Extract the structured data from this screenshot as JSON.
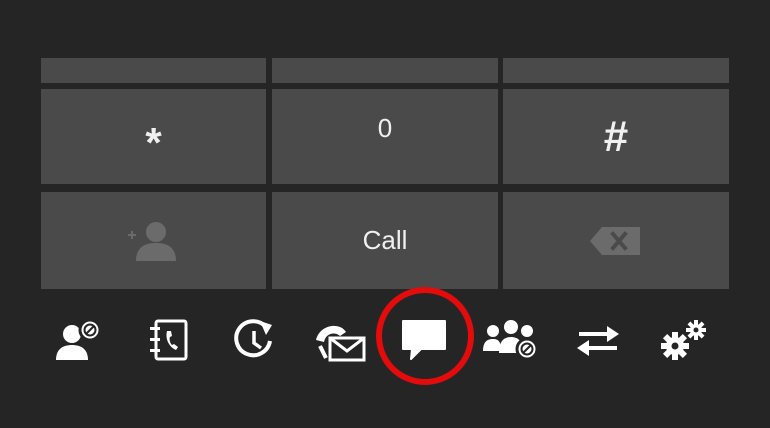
{
  "keypad": {
    "partial_row": [
      {
        "label": ""
      },
      {
        "label": ""
      },
      {
        "label": ""
      }
    ],
    "row2": {
      "star": "*",
      "zero": "0",
      "hash": "#"
    },
    "row3": {
      "add_contact_icon": "add-contact-icon",
      "call": "Call",
      "backspace_icon": "backspace-icon"
    }
  },
  "toolbar": {
    "items": [
      {
        "icon": "user-status-icon"
      },
      {
        "icon": "address-book-icon"
      },
      {
        "icon": "call-history-icon"
      },
      {
        "icon": "voicemail-icon"
      },
      {
        "icon": "chat-icon"
      },
      {
        "icon": "group-status-icon"
      },
      {
        "icon": "transfer-icon"
      },
      {
        "icon": "settings-icon"
      }
    ]
  },
  "colors": {
    "background": "#252525",
    "key": "#4a4a4a",
    "text": "#f0f0f0",
    "icon": "#ffffff",
    "highlight": "#e30b0b"
  }
}
